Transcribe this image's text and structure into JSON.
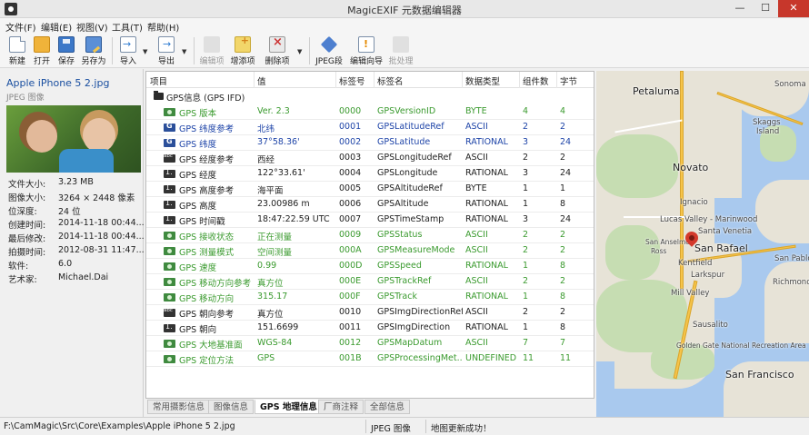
{
  "window": {
    "title": "MagicEXIF 元数据编辑器",
    "min_glyph": "—",
    "max_glyph": "☐",
    "close_glyph": "✕"
  },
  "menu": [
    "文件(F)",
    "编辑(E)",
    "视图(V)",
    "工具(T)",
    "帮助(H)"
  ],
  "toolbar": {
    "new": "新建",
    "open": "打开",
    "save": "保存",
    "save_as": "另存为",
    "import": "导入",
    "export": "导出",
    "edit_item": "编辑项",
    "add_item": "增添项",
    "delete_item": "删除项",
    "jpeg_segment": "JPEG段",
    "edit_wizard": "编辑向导",
    "batch": "批处理",
    "dropdown_glyph": "▼"
  },
  "file_info": {
    "name": "Apple iPhone 5 2.jpg",
    "type": "JPEG 图像",
    "properties": [
      {
        "key": "文件大小:",
        "value": "3.23 MB"
      },
      {
        "key": "图像大小:",
        "value": "3264 × 2448 像素"
      },
      {
        "key": "位深度:",
        "value": "24 位"
      },
      {
        "key": "创建时间:",
        "value": "2014-11-18 00:44..."
      },
      {
        "key": "最后修改:",
        "value": "2014-11-18 00:44..."
      },
      {
        "key": "拍摄时间:",
        "value": "2012-08-31 11:47..."
      },
      {
        "key": "软件:",
        "value": "6.0"
      },
      {
        "key": "艺术家:",
        "value": "Michael.Dai"
      }
    ]
  },
  "table": {
    "columns": [
      "项目",
      "值",
      "标签号",
      "标签名",
      "数据类型",
      "组件数",
      "字节"
    ],
    "group": "GPS信息 (GPS IFD)",
    "rows": [
      {
        "icon": "g",
        "color": "green",
        "name": "GPS 版本",
        "value": "Ver. 2.3",
        "tag": "0000",
        "tag_name": "GPSVersionID",
        "type": "BYTE",
        "count": "4",
        "bytes": "4"
      },
      {
        "icon": "b",
        "color": "blue",
        "name": "GPS 纬度参考",
        "value": "北纬",
        "tag": "0001",
        "tag_name": "GPSLatitudeRef",
        "type": "ASCII",
        "count": "2",
        "bytes": "2"
      },
      {
        "icon": "b",
        "color": "blue",
        "name": "GPS 纬度",
        "value": "37°58.36'",
        "tag": "0002",
        "tag_name": "GPSLatitude",
        "type": "RATIONAL",
        "count": "3",
        "bytes": "24"
      },
      {
        "icon": "d",
        "color": "dark",
        "name": "GPS 经度参考",
        "value": "西经",
        "tag": "0003",
        "tag_name": "GPSLongitudeRef",
        "type": "ASCII",
        "count": "2",
        "bytes": "2"
      },
      {
        "icon": "dn",
        "color": "dark",
        "name": "GPS 经度",
        "value": "122°33.61'",
        "tag": "0004",
        "tag_name": "GPSLongitude",
        "type": "RATIONAL",
        "count": "3",
        "bytes": "24"
      },
      {
        "icon": "dn",
        "color": "dark",
        "name": "GPS 高度参考",
        "value": "海平面",
        "tag": "0005",
        "tag_name": "GPSAltitudeRef",
        "type": "BYTE",
        "count": "1",
        "bytes": "1"
      },
      {
        "icon": "dn",
        "color": "dark",
        "name": "GPS 高度",
        "value": "23.00986 m",
        "tag": "0006",
        "tag_name": "GPSAltitude",
        "type": "RATIONAL",
        "count": "1",
        "bytes": "8"
      },
      {
        "icon": "dn",
        "color": "dark",
        "name": "GPS 时间戳",
        "value": "18:47:22.59 UTC",
        "tag": "0007",
        "tag_name": "GPSTimeStamp",
        "type": "RATIONAL",
        "count": "3",
        "bytes": "24"
      },
      {
        "icon": "g",
        "color": "green",
        "name": "GPS 接收状态",
        "value": "正在测量",
        "tag": "0009",
        "tag_name": "GPSStatus",
        "type": "ASCII",
        "count": "2",
        "bytes": "2"
      },
      {
        "icon": "g",
        "color": "green",
        "name": "GPS 测量模式",
        "value": "空间测量",
        "tag": "000A",
        "tag_name": "GPSMeasureMode",
        "type": "ASCII",
        "count": "2",
        "bytes": "2"
      },
      {
        "icon": "g",
        "color": "green",
        "name": "GPS 速度",
        "value": "0.99",
        "tag": "000D",
        "tag_name": "GPSSpeed",
        "type": "RATIONAL",
        "count": "1",
        "bytes": "8"
      },
      {
        "icon": "g",
        "color": "green",
        "name": "GPS 移动方向参考",
        "value": "真方位",
        "tag": "000E",
        "tag_name": "GPSTrackRef",
        "type": "ASCII",
        "count": "2",
        "bytes": "2"
      },
      {
        "icon": "g",
        "color": "green",
        "name": "GPS 移动方向",
        "value": "315.17",
        "tag": "000F",
        "tag_name": "GPSTrack",
        "type": "RATIONAL",
        "count": "1",
        "bytes": "8"
      },
      {
        "icon": "d",
        "color": "dark",
        "name": "GPS 朝向参考",
        "value": "真方位",
        "tag": "0010",
        "tag_name": "GPSImgDirectionRef",
        "type": "ASCII",
        "count": "2",
        "bytes": "2"
      },
      {
        "icon": "dn",
        "color": "dark",
        "name": "GPS 朝向",
        "value": "151.6699",
        "tag": "0011",
        "tag_name": "GPSImgDirection",
        "type": "RATIONAL",
        "count": "1",
        "bytes": "8"
      },
      {
        "icon": "g",
        "color": "green",
        "name": "GPS 大地基准面",
        "value": "WGS-84",
        "tag": "0012",
        "tag_name": "GPSMapDatum",
        "type": "ASCII",
        "count": "7",
        "bytes": "7"
      },
      {
        "icon": "g",
        "color": "green",
        "name": "GPS 定位方法",
        "value": "GPS",
        "tag": "001B",
        "tag_name": "GPSProcessingMet...",
        "type": "UNDEFINED",
        "count": "11",
        "bytes": "11"
      }
    ]
  },
  "tabs": [
    {
      "label": "常用摄影信息",
      "active": false
    },
    {
      "label": "图像信息",
      "active": false
    },
    {
      "label": "GPS 地理信息",
      "active": true
    },
    {
      "label": "厂商注释",
      "active": false
    },
    {
      "label": "全部信息",
      "active": false
    }
  ],
  "map": {
    "labels": {
      "petaluma": "Petaluma",
      "sonoma": "Sonoma",
      "skaggs": "Skaggs",
      "island": "Island",
      "novato": "Novato",
      "ignacio": "Ignacio",
      "lucas_valley": "Lucas Valley - Marinwood",
      "santa_venetia": "Santa Venetia",
      "san_rafael": "San Rafael",
      "kentfield": "Kentfield",
      "larkspur": "Larkspur",
      "san_pablo": "San Pablo",
      "richmond": "Richmond",
      "mill_valley": "Mill Valley",
      "sausalito": "Sausalito",
      "golden_gate": "Golden Gate National Recreation Area",
      "san_francisco": "San Francisco",
      "ross": "Ross",
      "san_anselmo": "San Anselmo"
    }
  },
  "status": {
    "path": "F:\\CamMagic\\Src\\Core\\Examples\\Apple iPhone 5 2.jpg",
    "type": "JPEG 图像",
    "message": "地图更新成功！"
  },
  "colors": {
    "green_text": "#3a9a2e",
    "blue_text": "#1f45a8",
    "close_button": "#c7372b",
    "title_link": "#1a4fa0",
    "water": "#a9c9ee",
    "land": "#e7e3d7"
  }
}
